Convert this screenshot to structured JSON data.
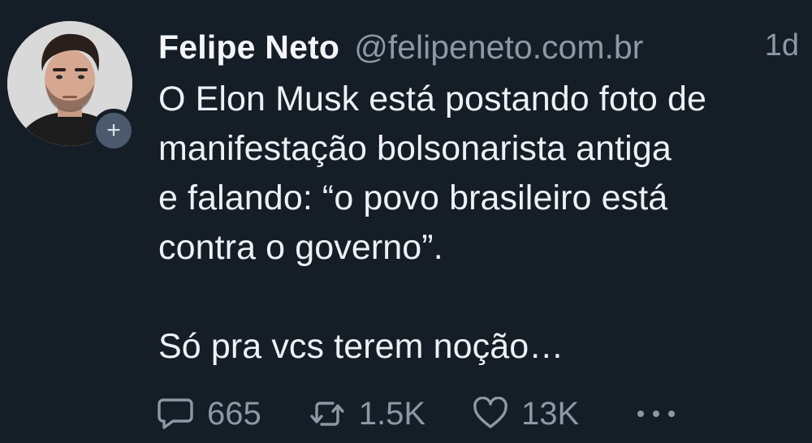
{
  "tweet": {
    "author_name": "Felipe Neto",
    "handle": "@felipeneto.com.br",
    "time": "1d",
    "text": "O Elon Musk está postando foto de\nmanifestação bolsonarista antiga\ne falando: “o povo brasileiro está\ncontra o governo”.\n\nSó pra vcs terem noção…",
    "follow_badge": "+"
  },
  "actions": {
    "replies": "665",
    "retweets": "1.5K",
    "likes": "13K"
  },
  "icons": {
    "reply": "reply-icon",
    "retweet": "retweet-icon",
    "like": "heart-icon",
    "more": "more-icon"
  },
  "colors": {
    "background": "#151d27",
    "muted": "#8b98a5",
    "text": "#eef1f4",
    "badge": "#4a5a6c"
  }
}
